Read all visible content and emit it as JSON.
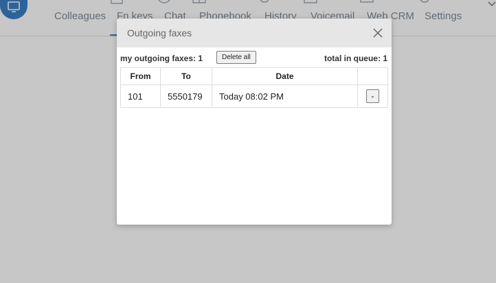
{
  "nav": {
    "items": [
      {
        "label": "Colleagues",
        "icon": "people-icon"
      },
      {
        "label": "Fn keys",
        "icon": "grid-icon"
      },
      {
        "label": "Chat",
        "icon": "chat-icon"
      },
      {
        "label": "Phonebook",
        "icon": "book-icon"
      },
      {
        "label": "History",
        "icon": "history-icon"
      },
      {
        "label": "Voicemail",
        "icon": "voicemail-icon"
      },
      {
        "label": "Web CRM",
        "icon": "crm-icon"
      },
      {
        "label": "Settings",
        "icon": "gear-icon"
      }
    ],
    "active_index": 1,
    "accent_color": "#3a7fc4"
  },
  "dialog": {
    "title": "Outgoing faxes",
    "my_outgoing": "my outgoing faxes: 1",
    "delete_all_label": "Delete all",
    "total_in_queue": "total in queue: 1",
    "columns": [
      "From",
      "To",
      "Date",
      ""
    ],
    "rows": [
      {
        "from": "101",
        "to": "5550179",
        "date": "Today 08:02 PM",
        "action_label": "-"
      }
    ]
  }
}
